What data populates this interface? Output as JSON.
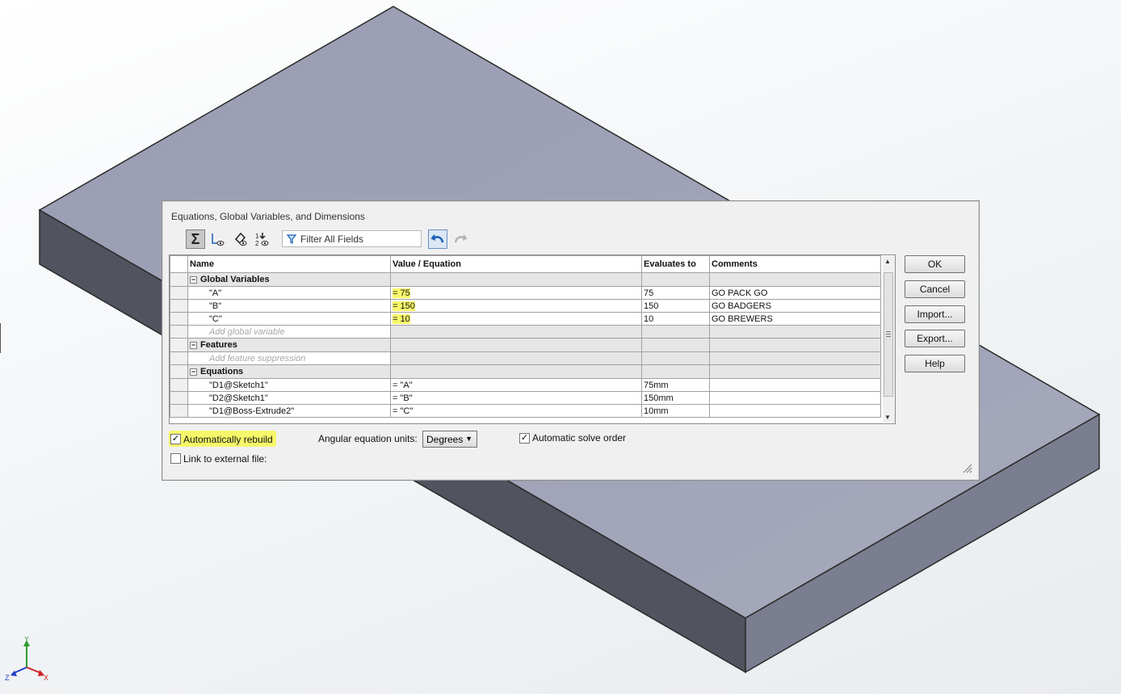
{
  "dialog": {
    "title": "Equations, Global Variables, and Dimensions",
    "filter_placeholder": "Filter All Fields"
  },
  "grid": {
    "headers": [
      "Name",
      "Value / Equation",
      "Evaluates to",
      "Comments"
    ],
    "sections": {
      "global_variables": "Global Variables",
      "features": "Features",
      "equations": "Equations"
    },
    "global_variables": [
      {
        "name": "\"A\"",
        "value": "= 75",
        "evaluates": "75",
        "comment": "GO PACK GO"
      },
      {
        "name": "\"B\"",
        "value": "= 150",
        "evaluates": "150",
        "comment": "GO BADGERS"
      },
      {
        "name": "\"C\"",
        "value": "= 10",
        "evaluates": "10",
        "comment": "GO BREWERS"
      }
    ],
    "add_global_variable": "Add global variable",
    "add_feature_suppression": "Add feature suppression",
    "equations": [
      {
        "name": "\"D1@Sketch1\"",
        "value": "= \"A\"",
        "evaluates": "75mm",
        "comment": ""
      },
      {
        "name": "\"D2@Sketch1\"",
        "value": "= \"B\"",
        "evaluates": "150mm",
        "comment": ""
      },
      {
        "name": "\"D1@Boss-Extrude2\"",
        "value": "= \"C\"",
        "evaluates": "10mm",
        "comment": ""
      }
    ]
  },
  "buttons": {
    "ok": "OK",
    "cancel": "Cancel",
    "import": "Import...",
    "export": "Export...",
    "help": "Help"
  },
  "options": {
    "auto_rebuild": "Automatically rebuild",
    "auto_rebuild_checked": true,
    "angular_units_label": "Angular equation units:",
    "angular_units_value": "Degrees",
    "auto_solve_order": "Automatic solve order",
    "auto_solve_order_checked": true,
    "link_external": "Link to external file:",
    "link_external_checked": false
  },
  "triad": {
    "x": "X",
    "y": "Y",
    "z": "Z"
  },
  "colors": {
    "highlight": "#f7f76a",
    "part_top": "#a0a3b8",
    "part_side_dark": "#50525e",
    "part_side_right": "#7b7e90"
  }
}
